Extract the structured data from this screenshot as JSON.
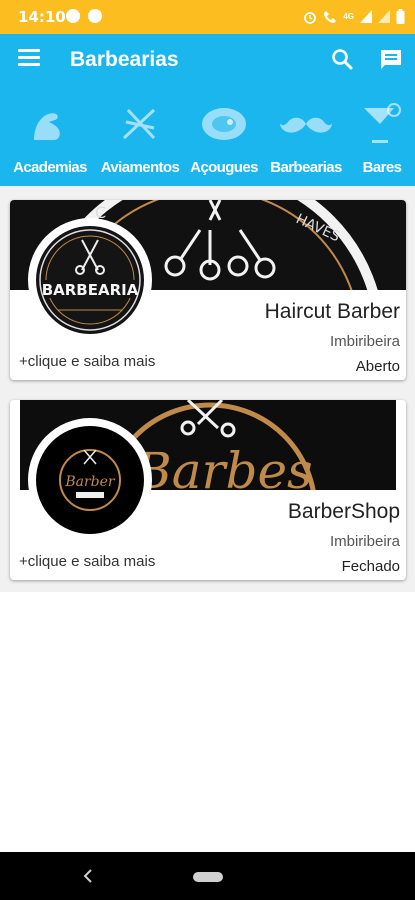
{
  "status_bar": {
    "time": "14:10",
    "network": "4G"
  },
  "app_bar": {
    "title": "Barbearias",
    "menu_icon": "menu-icon",
    "search_icon": "search-icon",
    "chat_icon": "chat-icon"
  },
  "categories": [
    {
      "label": "Academias",
      "icon": "arm-icon"
    },
    {
      "label": "Aviamentos",
      "icon": "sewing-icon"
    },
    {
      "label": "Açougues",
      "icon": "steak-icon"
    },
    {
      "label": "Barbearias",
      "icon": "mustache-icon"
    },
    {
      "label": "Bares",
      "icon": "cocktail-icon"
    }
  ],
  "listings": [
    {
      "name": "Haircut Barber",
      "city": "Imbiribeira",
      "status": "Aberto",
      "more": "+clique e saiba mais",
      "logo_text": "BARBEARIA"
    },
    {
      "name": "BarberShop",
      "city": "Imbiribeira",
      "status": "Fechado",
      "more": "+clique e saiba mais",
      "logo_text": "Barber"
    }
  ],
  "colors": {
    "status_bar": "#fbbd20",
    "primary": "#1cb6ef",
    "banner": "#111111",
    "gold": "#c08a4a"
  }
}
